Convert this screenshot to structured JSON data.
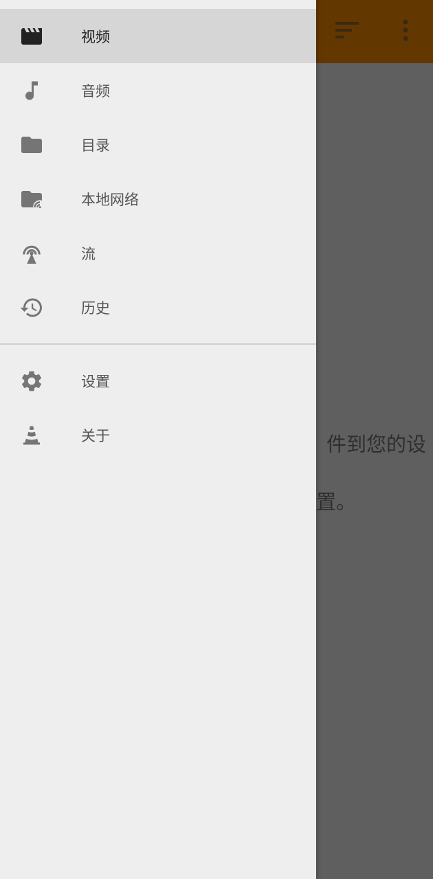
{
  "drawer": {
    "main_items": [
      {
        "label": "视频",
        "icon": "video-clapper-icon",
        "active": true
      },
      {
        "label": "音频",
        "icon": "music-note-icon",
        "active": false
      },
      {
        "label": "目录",
        "icon": "folder-icon",
        "active": false
      },
      {
        "label": "本地网络",
        "icon": "network-folder-icon",
        "active": false
      },
      {
        "label": "流",
        "icon": "stream-antenna-icon",
        "active": false
      },
      {
        "label": "历史",
        "icon": "history-icon",
        "active": false
      }
    ],
    "secondary_items": [
      {
        "label": "设置",
        "icon": "gear-icon"
      },
      {
        "label": "关于",
        "icon": "vlc-cone-icon"
      }
    ]
  },
  "appbar": {
    "actions": [
      "sort-icon",
      "more-vert-icon"
    ]
  },
  "background": {
    "empty_line1": "件到您的设",
    "empty_line2": "置。"
  },
  "colors": {
    "appbar": "#633700",
    "scrim": "#5f5f5f",
    "drawer_bg": "#eeeeee",
    "active_bg": "#d6d6d6",
    "icon": "#757575",
    "active_icon": "#222222"
  }
}
